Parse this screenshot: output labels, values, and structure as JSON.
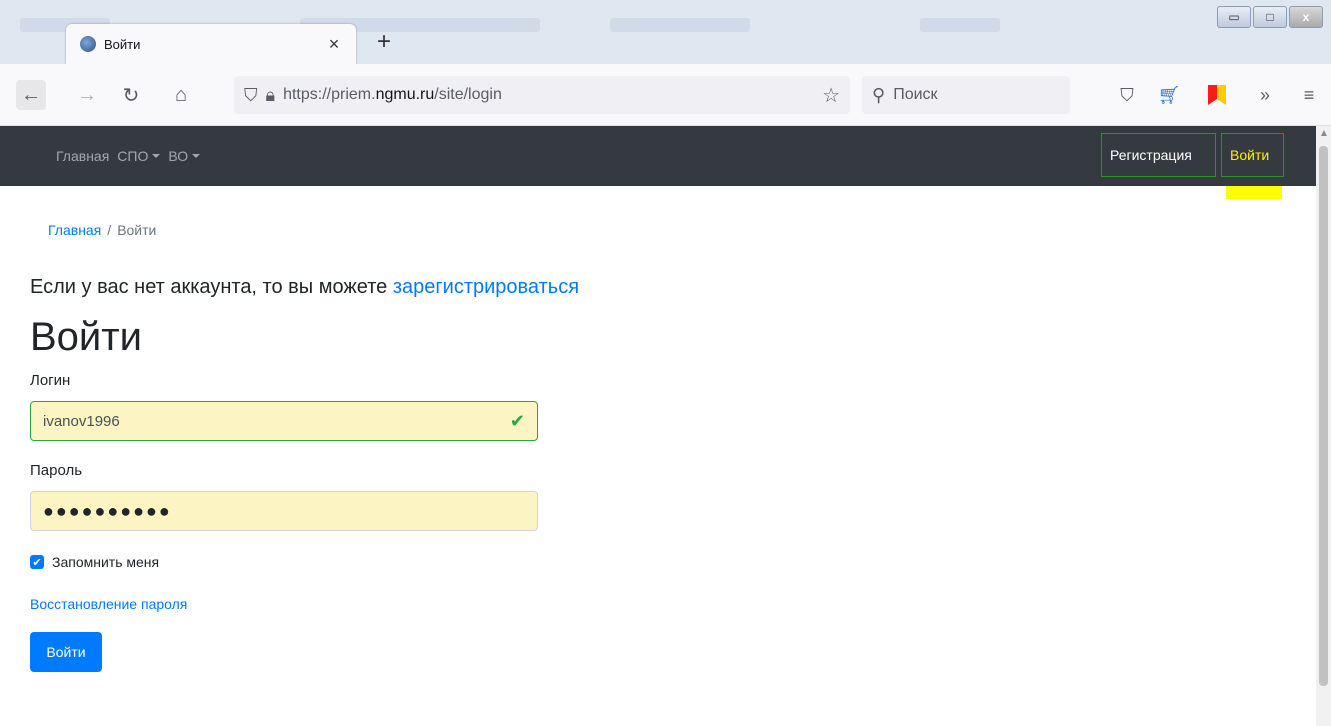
{
  "browser": {
    "tab": {
      "title": "Войти"
    },
    "new_tab_symbol": "+",
    "url": {
      "prefix": "https://priem.",
      "domain": "ngmu.ru",
      "path": "/site/login"
    },
    "search_placeholder": "Поиск",
    "icons": {
      "back": "arrow-left-icon",
      "forward": "arrow-right-icon",
      "reload": "reload-icon",
      "home": "home-icon",
      "shield": "shield-icon",
      "lock": "lock-icon",
      "bookmark": "star-icon",
      "pocket": "pocket-icon",
      "cart": "cart-icon",
      "flag": "flag-icon",
      "overflow": "chevron-double-right-icon",
      "menu": "hamburger-menu-icon"
    }
  },
  "site_nav": {
    "items": [
      {
        "label": "Главная",
        "dropdown": false
      },
      {
        "label": "СПО",
        "dropdown": true
      },
      {
        "label": "ВО",
        "dropdown": true
      }
    ],
    "register_label": "Регистрация",
    "login_label": "Войти"
  },
  "breadcrumb": {
    "home": "Главная",
    "separator": "/",
    "current": "Войти"
  },
  "register_prompt": {
    "text": "Если у вас нет аккаунта, то вы можете ",
    "link": "зарегистрироваться"
  },
  "form": {
    "title": "Войти",
    "login_label": "Логин",
    "login_value": "ivanov1996",
    "password_label": "Пароль",
    "password_value": "●●●●●●●●●●",
    "remember_label": "Запомнить меня",
    "remember_checked": true,
    "forgot_link": "Восстановление пароля",
    "submit_label": "Войти"
  },
  "colors": {
    "navbar_bg": "#343a40",
    "link": "#007bff",
    "valid": "#28a745",
    "highlight": "#ffff00",
    "autofill_bg": "#fdf4c3"
  }
}
